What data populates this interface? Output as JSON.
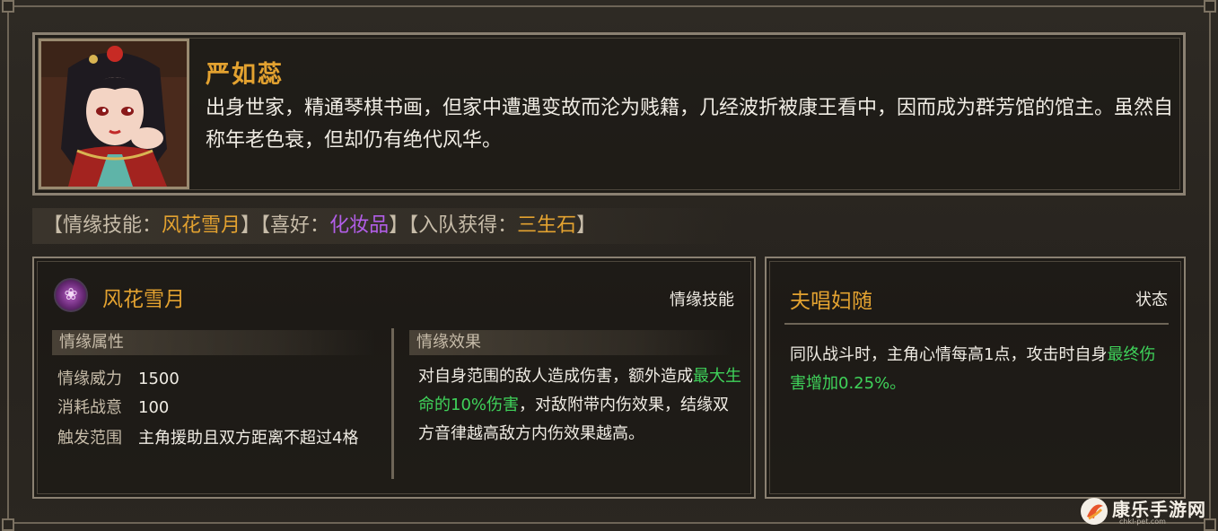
{
  "character": {
    "name": "严如蕊",
    "description": "出身世家，精通琴棋书画，但家中遭遇变故而沦为贱籍，几经波折被康王看中，因而成为群芳馆的馆主。虽然自称年老色衰，但却仍有绝代风华。"
  },
  "info_strip": {
    "skill_label": "【情缘技能：",
    "skill_value": "风花雪月",
    "skill_close": "】",
    "hobby_label": "【喜好：",
    "hobby_value": "化妆品",
    "hobby_close": "】",
    "join_label": "【入队获得：",
    "join_value": "三生石",
    "join_close": "】"
  },
  "skill": {
    "title": "风花雪月",
    "tag": "情缘技能",
    "icon": "flower-skill-icon",
    "attributes_header": "情缘属性",
    "attributes": [
      {
        "key": "情缘威力",
        "value": "1500"
      },
      {
        "key": "消耗战意",
        "value": "100"
      },
      {
        "key": "触发范围",
        "value": "主角援助且双方距离不超过4格"
      }
    ],
    "effect_header": "情缘效果",
    "effect_part1": "对自身范围的敌人造成伤害，额外造成",
    "effect_highlight": "最大生命的10%伤害",
    "effect_part2": "，对敌附带内伤效果，结缘双方音律越高敌方内伤效果越高。"
  },
  "status": {
    "title": "夫唱妇随",
    "tag": "状态",
    "text_part1": "同队战斗时，主角心情每高1点，攻击时自身",
    "text_highlight": "最终伤害增加0.25%。"
  },
  "watermark": {
    "name": "康乐手游网",
    "url": "chkl-pet.com"
  },
  "colors": {
    "name_gold": "#e3a230",
    "hobby_purple": "#b25ee8",
    "highlight_green": "#3fd25a",
    "border": "#8b8172",
    "background": "#2a2620"
  }
}
